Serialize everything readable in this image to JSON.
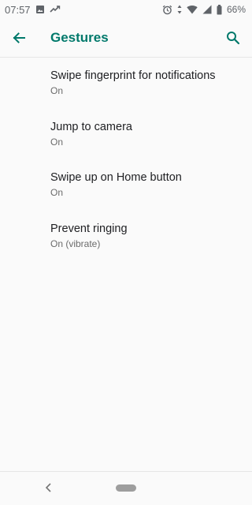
{
  "status_bar": {
    "time": "07:57",
    "battery": "66%",
    "icons": [
      "image-icon",
      "sync-icon",
      "alarm-icon",
      "data-arrows-icon",
      "wifi-icon",
      "signal-icon",
      "battery-icon"
    ]
  },
  "app_bar": {
    "title": "Gestures",
    "back_icon": "arrow-back-icon",
    "search_icon": "search-icon"
  },
  "items": [
    {
      "title": "Swipe fingerprint for notifications",
      "summary": "On"
    },
    {
      "title": "Jump to camera",
      "summary": "On"
    },
    {
      "title": "Swipe up on Home button",
      "summary": "On"
    },
    {
      "title": "Prevent ringing",
      "summary": "On (vibrate)"
    }
  ],
  "colors": {
    "accent": "#00796b",
    "background": "#fafafa",
    "title_text": "#202124",
    "summary_text": "#6b6b6b"
  }
}
